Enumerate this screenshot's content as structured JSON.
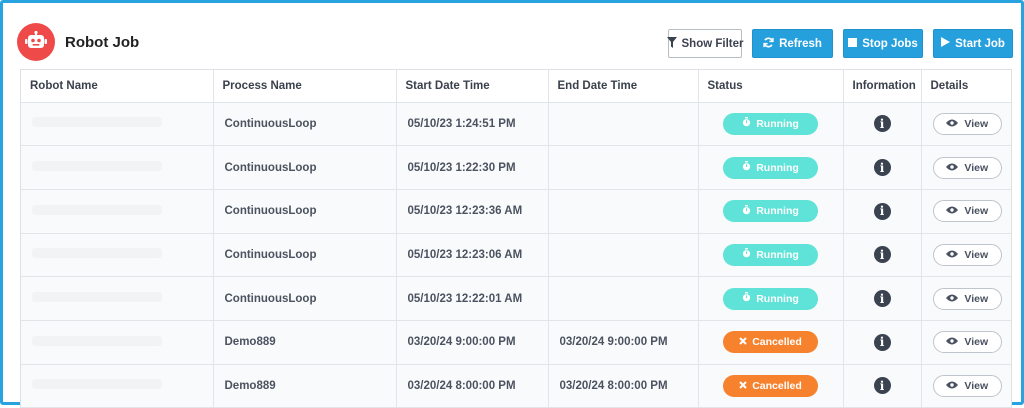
{
  "header": {
    "title": "Robot Job",
    "logo_icon": "robot-icon",
    "brand_color": "#ef4a4a"
  },
  "toolbar": {
    "show_filter_label": "Show Filter",
    "refresh_label": "Refresh",
    "stop_jobs_label": "Stop Jobs",
    "start_job_label": "Start Job",
    "primary_color": "#25a0dd"
  },
  "table": {
    "columns": [
      "Robot Name",
      "Process Name",
      "Start Date Time",
      "End Date Time",
      "Status",
      "Information",
      "Details"
    ],
    "view_label": "View",
    "rows": [
      {
        "robot_name": "",
        "process": "ContinuousLoop",
        "start": "05/10/23 1:24:51 PM",
        "end": "",
        "status": "Running"
      },
      {
        "robot_name": "",
        "process": "ContinuousLoop",
        "start": "05/10/23 1:22:30 PM",
        "end": "",
        "status": "Running"
      },
      {
        "robot_name": "",
        "process": "ContinuousLoop",
        "start": "05/10/23 12:23:36 AM",
        "end": "",
        "status": "Running"
      },
      {
        "robot_name": "",
        "process": "ContinuousLoop",
        "start": "05/10/23 12:23:06 AM",
        "end": "",
        "status": "Running"
      },
      {
        "robot_name": "",
        "process": "ContinuousLoop",
        "start": "05/10/23 12:22:01 AM",
        "end": "",
        "status": "Running"
      },
      {
        "robot_name": "",
        "process": "Demo889",
        "start": "03/20/24 9:00:00 PM",
        "end": "03/20/24 9:00:00 PM",
        "status": "Cancelled"
      },
      {
        "robot_name": "",
        "process": "Demo889",
        "start": "03/20/24 8:00:00 PM",
        "end": "03/20/24 8:00:00 PM",
        "status": "Cancelled"
      }
    ]
  },
  "status_colors": {
    "Running": "#5fe3d8",
    "Cancelled": "#f7822e"
  }
}
